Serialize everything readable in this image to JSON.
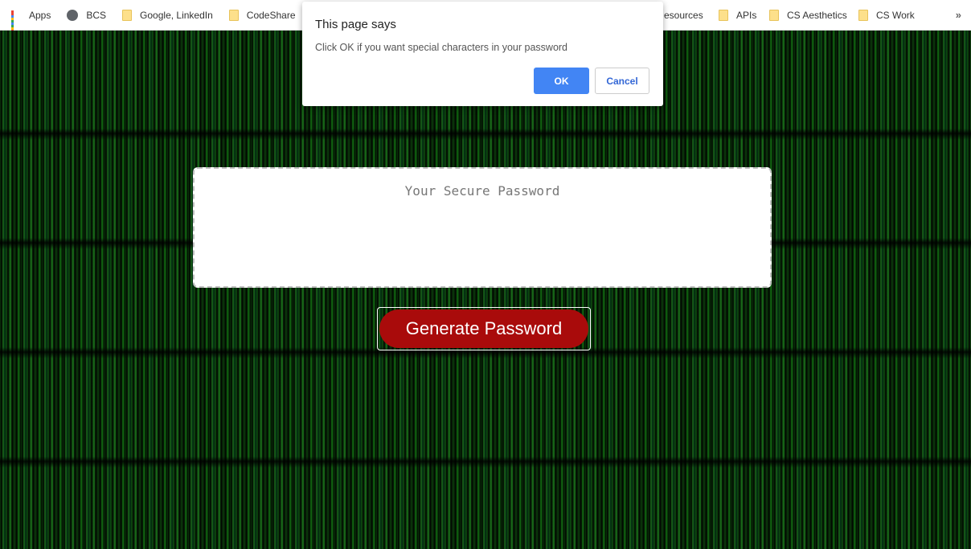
{
  "bookmarks": {
    "items": [
      {
        "label": "Apps",
        "icon": "apps-icon"
      },
      {
        "label": "BCS",
        "icon": "globe-icon"
      },
      {
        "label": "Google, LinkedIn",
        "icon": "folder-icon"
      },
      {
        "label": "CodeShare",
        "icon": "folder-icon"
      },
      {
        "label": "",
        "icon": "folder-icon"
      },
      {
        "label": "esources",
        "icon": "folder-icon"
      },
      {
        "label": "APIs",
        "icon": "folder-icon"
      },
      {
        "label": "CS Aesthetics",
        "icon": "folder-icon"
      },
      {
        "label": "CS Work",
        "icon": "folder-icon"
      }
    ],
    "more": "»"
  },
  "main": {
    "password_placeholder": "Your Secure Password",
    "generate_label": "Generate Password",
    "button_color": "#a90b0b"
  },
  "dialog": {
    "title": "This page says",
    "message": "Click OK if you want special characters in your password",
    "ok_label": "OK",
    "cancel_label": "Cancel"
  }
}
